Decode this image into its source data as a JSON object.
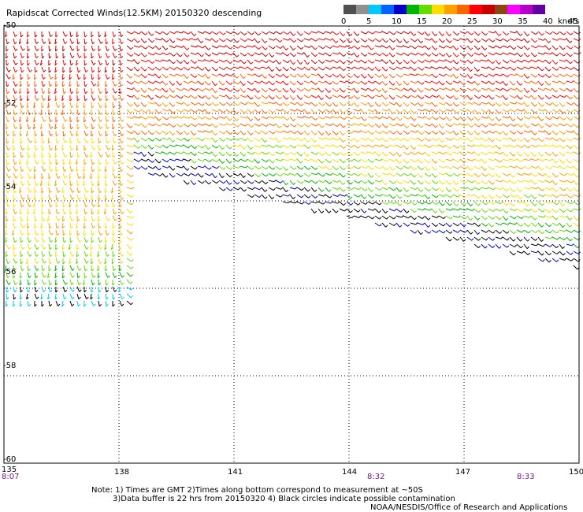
{
  "title": "Rapidscat Corrected Winds(12.5KM) 20150320 descending",
  "legend": {
    "colors": [
      "#505050",
      "#909090",
      "#00c8ff",
      "#0064ff",
      "#0000c8",
      "#00b400",
      "#64dc00",
      "#ffdc00",
      "#ffa000",
      "#ff6400",
      "#ff0000",
      "#c80000",
      "#8c4614",
      "#ff00ff",
      "#b400c8",
      "#6400a0"
    ],
    "labels": [
      "0",
      "5",
      "10",
      "15",
      "20",
      "25",
      "30",
      "35",
      "40",
      "45",
      ">50"
    ],
    "units": "knots"
  },
  "axes": {
    "lon_labels": [
      "135",
      "138",
      "141",
      "144",
      "147",
      "150"
    ],
    "lat_labels": [
      "-50",
      "-52",
      "-54",
      "-56",
      "-58",
      "-60"
    ]
  },
  "times": [
    "8:07",
    "8:32",
    "8:33"
  ],
  "notes": {
    "line1": "Note: 1) Times are GMT 2)Times along bottom correspond to measurement at ~50S",
    "line2": "3)Data buffer is 22 hrs from 20150320 4) Black circles indicate possible contamination",
    "credit": "NOAA/NESDIS/Office of Research and Applications"
  },
  "wind_field": {
    "lon_range": [
      135,
      150
    ],
    "lat_range": [
      -60,
      -50
    ],
    "speed_knots_by_region": {
      "north_of_52S": "30-40",
      "52S_to_53S": "20-30",
      "53S_to_54S": "15-25",
      "near_swath_edge": "0-15"
    }
  }
}
